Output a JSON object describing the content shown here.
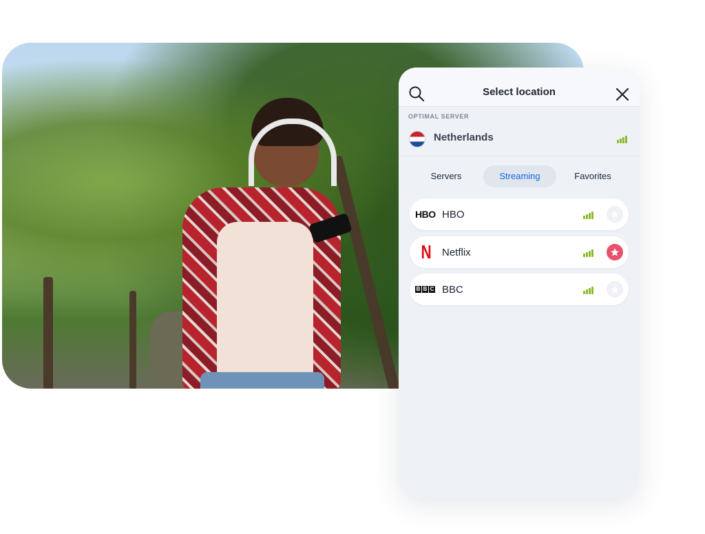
{
  "header": {
    "title": "Select location"
  },
  "optimal": {
    "section_label": "OPTIMAL SERVER",
    "country": "Netherlands"
  },
  "tabs": [
    {
      "label": "Servers",
      "active": false
    },
    {
      "label": "Streaming",
      "active": true
    },
    {
      "label": "Favorites",
      "active": false
    }
  ],
  "services": [
    {
      "name": "HBO",
      "logo_text": "HBO",
      "favorite": false
    },
    {
      "name": "Netflix",
      "logo_text": "N",
      "favorite": true
    },
    {
      "name": "BBC",
      "logo_text": "BBC",
      "favorite": false
    }
  ],
  "colors": {
    "accent": "#1a66d9",
    "signal": "#8dba2d",
    "favorite": "#e9506b",
    "netflix": "#e50914"
  }
}
